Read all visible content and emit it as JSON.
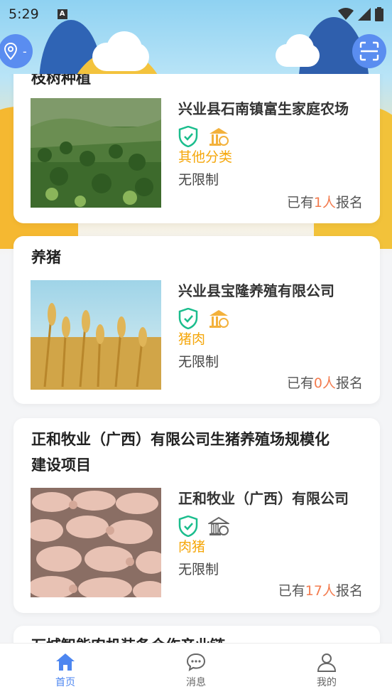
{
  "status_bar": {
    "time": "5:29",
    "notification_icon": "A"
  },
  "location_button": {
    "label": "-"
  },
  "cards": [
    {
      "title": "枝树种植",
      "company": "兴业县石南镇富生家庭农场",
      "category": "其他分类",
      "limit": "无限制",
      "signup_prefix": "已有",
      "signup_count": "1人",
      "signup_suffix": "报名",
      "image": "forest-photo"
    },
    {
      "title": "养猪",
      "company": "兴业县宝隆养殖有限公司",
      "category": "猪肉",
      "limit": "无限制",
      "signup_prefix": "已有",
      "signup_count": "0人",
      "signup_suffix": "报名",
      "image": "wheat-photo"
    },
    {
      "title_line1": "正和牧业（广西）有限公司生猪养殖场规模化",
      "title_line2": "建设项目",
      "company": "正和牧业（广西）有限公司",
      "category": "肉猪",
      "limit": "无限制",
      "signup_prefix": "已有",
      "signup_count": "17人",
      "signup_suffix": "报名",
      "image": "pigs-photo"
    },
    {
      "title": "万城智能农机装备合作产业链"
    }
  ],
  "bottom_nav": [
    {
      "label": "首页",
      "icon": "home-icon",
      "active": true
    },
    {
      "label": "消息",
      "icon": "message-icon",
      "active": false
    },
    {
      "label": "我的",
      "icon": "user-icon",
      "active": false
    }
  ],
  "colors": {
    "accent": "#4d86f0",
    "category": "#f5a70b",
    "count": "#f37c4f",
    "verify_green": "#1bbd8d",
    "bank_gold": "#f3b13b"
  }
}
